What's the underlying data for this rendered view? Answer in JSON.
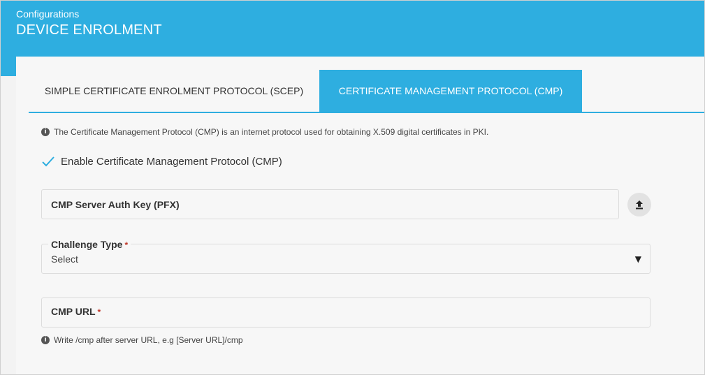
{
  "header": {
    "breadcrumb": "Configurations",
    "title": "DEVICE ENROLMENT",
    "background_color": "#2eaee0"
  },
  "tabs": [
    {
      "label": "SIMPLE CERTIFICATE ENROLMENT PROTOCOL (SCEP)",
      "active": false
    },
    {
      "label": "CERTIFICATE MANAGEMENT PROTOCOL (CMP)",
      "active": true
    }
  ],
  "info": {
    "icon": "info-circle-icon",
    "text": "The Certificate Management Protocol (CMP) is an internet protocol used for obtaining X.509 digital certificates in PKI."
  },
  "enable_cmp": {
    "label": "Enable Certificate Management Protocol (CMP)",
    "checked": true,
    "icon": "checkmark-icon"
  },
  "auth_key": {
    "label": "CMP Server Auth Key (PFX)",
    "upload_icon": "upload-icon"
  },
  "challenge_type": {
    "label": "Challenge Type",
    "required_mark": "*",
    "value": "Select",
    "icon": "caret-down-icon"
  },
  "cmp_url": {
    "label": "CMP URL",
    "required_mark": "*",
    "hint": "Write /cmp after server URL, e.g [Server URL]/cmp"
  }
}
